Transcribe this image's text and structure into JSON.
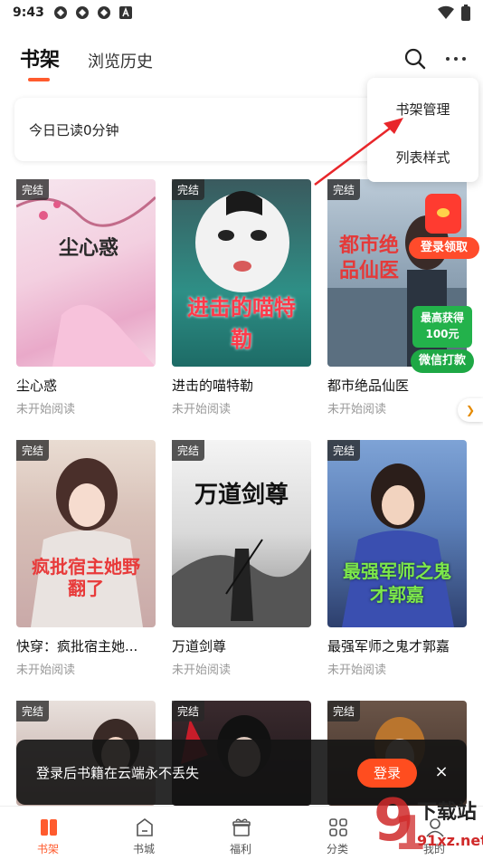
{
  "status_bar": {
    "time": "9:43"
  },
  "header": {
    "tab_active": "书架",
    "tab_history": "浏览历史"
  },
  "read_card": {
    "text": "今日已读0分钟"
  },
  "menu": {
    "item_manage": "书架管理",
    "item_list_style": "列表样式"
  },
  "books": [
    {
      "badge": "完结",
      "title": "尘心惑",
      "status": "未开始阅读",
      "cover_text": "尘心惑"
    },
    {
      "badge": "完结",
      "title": "进击的喵特勒",
      "status": "未开始阅读",
      "cover_text": "进击的喵特勒"
    },
    {
      "badge": "完结",
      "title": "都市绝品仙医",
      "status": "未开始阅读",
      "cover_text": "都市绝品仙医"
    },
    {
      "badge": "完结",
      "title": "快穿：疯批宿主她...",
      "status": "未开始阅读",
      "cover_text": "疯批宿主她野翻了"
    },
    {
      "badge": "完结",
      "title": "万道剑尊",
      "status": "未开始阅读",
      "cover_text": "万道剑尊"
    },
    {
      "badge": "完结",
      "title": "最强军师之鬼才郭嘉",
      "status": "未开始阅读",
      "cover_text": "最强军师之鬼才郭嘉"
    },
    {
      "badge": "完结"
    },
    {
      "badge": "完结"
    },
    {
      "badge": "完结"
    }
  ],
  "promo": {
    "redpacket_label": "登录领取",
    "wechat_line1": "最高获得",
    "wechat_line2": "100元",
    "wechat_button": "微信打款"
  },
  "toast": {
    "text": "登录后书籍在云端永不丢失",
    "login_button": "登录",
    "close": "×"
  },
  "bottom_nav": [
    {
      "label": "书架",
      "active": true
    },
    {
      "label": "书城"
    },
    {
      "label": "福利"
    },
    {
      "label": "分类"
    },
    {
      "label": "我的"
    }
  ],
  "watermark": {
    "line1": "下载站",
    "line2": "91xz.net"
  },
  "colors": {
    "accent": "#ff5b2e",
    "toast_bg": "#141414",
    "wechat_green": "#23b24b"
  }
}
